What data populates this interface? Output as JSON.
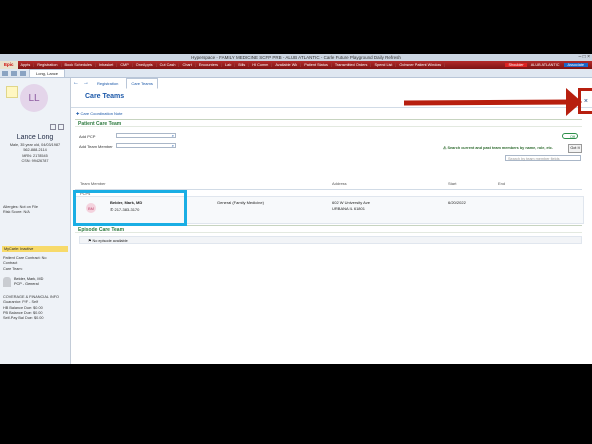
{
  "window": {
    "title": "Hyperspace - FAMILY MEDICINE SCFP PRB - ALUB ATLANTIC - Carle Future Playground Daily Refresh",
    "buttons": [
      "–",
      "□",
      "×"
    ]
  },
  "menubar": {
    "epic_label": "Epic",
    "items": [
      "Appts",
      "Registration",
      "Book Schedules",
      "Inbasket",
      "CMP",
      "OneAppts",
      "Cut Cash",
      "Chart",
      "Encounters",
      "Lab",
      "Bills",
      "HI Comm",
      "Available Wk",
      "Patient Status",
      "Transmitted Orders",
      "Spend List"
    ],
    "right_items": [
      "Ochsner Patient Window"
    ],
    "environment": "Shoulder",
    "dept": "ALUB ATLANTIC",
    "user": "Associate"
  },
  "patient_tab": {
    "label": "Long, Lance"
  },
  "sidebar": {
    "initials": "LL",
    "name": "Lance Long",
    "info": [
      "Male, 35 year old, 04/03/1987",
      "562-888-2114",
      "MRN: 2178545",
      "CSN: 99426787"
    ],
    "allergies": "Allergies: Not on File",
    "risk": "Risk Score: N/A",
    "mycarle": "MyCarle: Inactive",
    "care_contract": [
      "Patient Care Contract: No",
      "Contract"
    ],
    "care_team_label": "Care Team:",
    "pcp_name": "Belder, Mark, MD",
    "pcp_role": "PCP - General",
    "coverage": [
      "COVERAGE & FINANCIAL INFO",
      "Guarantor: P/F - Self",
      "HB Balance Due: $0.00",
      "PB Balance Due: $0.00",
      "Self-Pay Bal Due: $0.00"
    ]
  },
  "activity_tabs": [
    "Registration",
    "Care Teams"
  ],
  "page": {
    "title": "Care Teams",
    "close": "×",
    "coordination_note": "Care Coordination Note"
  },
  "patient_care_team": {
    "header": "Patient Care Team",
    "add_pcp_label": "Add PCP",
    "add_team_member_label": "Add Team Member",
    "toggle_label": "Off",
    "search_hint": "Search current and past team members by name, role, etc.",
    "go_button": "Got It",
    "filter_placeholder": "Search by team member fields",
    "columns": [
      "Team Member",
      "Address",
      "Start",
      "End"
    ],
    "pcps_label": "PCPs",
    "members": [
      {
        "initials": "BM",
        "name": "Belder, Mark, MD",
        "phone": "217-383-3170",
        "specialty": "General (Family Medicine)",
        "address": [
          "602 W University Ave",
          "URBANA IL 61801"
        ],
        "start": "6/20/2022",
        "end": ""
      }
    ]
  },
  "episode_care_team": {
    "header": "Episode Care Team",
    "empty_message": "No episode available"
  },
  "colors": {
    "menubar": "#b42a2a",
    "accent_blue": "#1a57a8",
    "section_green": "#2e7a3f",
    "highlight_cyan": "#1aaee4",
    "annotation_red": "#b71f0f"
  }
}
